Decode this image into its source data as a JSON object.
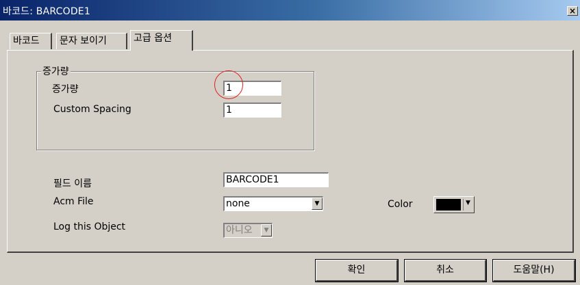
{
  "window": {
    "title": "바코드: BARCODE1",
    "close_label": "×"
  },
  "tabs": [
    {
      "label": "바코드"
    },
    {
      "label": "문자 보이기"
    },
    {
      "label": "고급 옵션",
      "active": true
    }
  ],
  "increment_group": {
    "legend": "증가량",
    "increment_label": "증가량",
    "increment_value": "1",
    "custom_spacing_label": "Custom Spacing",
    "custom_spacing_value": "1"
  },
  "field_name": {
    "label": "필드 이름",
    "value": "BARCODE1"
  },
  "acm_file": {
    "label": "Acm File",
    "value": "none"
  },
  "color": {
    "label": "Color",
    "value": "#000000"
  },
  "log_object": {
    "label": "Log this Object",
    "value": "아니오"
  },
  "buttons": {
    "ok": "확인",
    "cancel": "취소",
    "help": "도움말(H)"
  },
  "icons": {
    "dropdown": "▼"
  },
  "accent_colors": {
    "titlebar": "#0a246a",
    "highlight": "#e02020"
  }
}
